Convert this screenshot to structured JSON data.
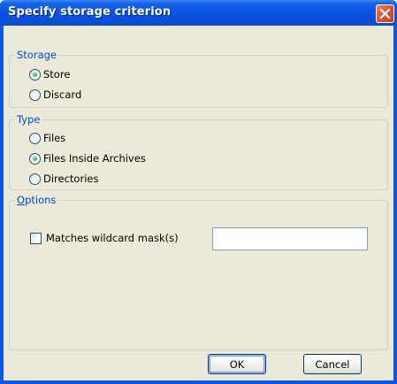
{
  "dialog": {
    "title": "Specify storage criterion"
  },
  "storage": {
    "label": "Storage",
    "options": [
      {
        "label": "Store",
        "checked": true
      },
      {
        "label": "Discard",
        "checked": false
      }
    ]
  },
  "type": {
    "label": "Type",
    "options": [
      {
        "label": "Files",
        "checked": false
      },
      {
        "label": "Files Inside Archives",
        "checked": true
      },
      {
        "label": "Directories",
        "checked": false
      }
    ]
  },
  "options": {
    "label_first": "O",
    "label_rest": "ptions",
    "wildcard_label": "Matches wildcard mask(s)",
    "wildcard_checked": false,
    "wildcard_value": ""
  },
  "buttons": {
    "ok": "OK",
    "cancel": "Cancel"
  },
  "colors": {
    "title_bar": "#0a52e0",
    "group_label": "#0046d5",
    "dialog_bg": "#ece9d8",
    "close_button": "#e0522c"
  }
}
